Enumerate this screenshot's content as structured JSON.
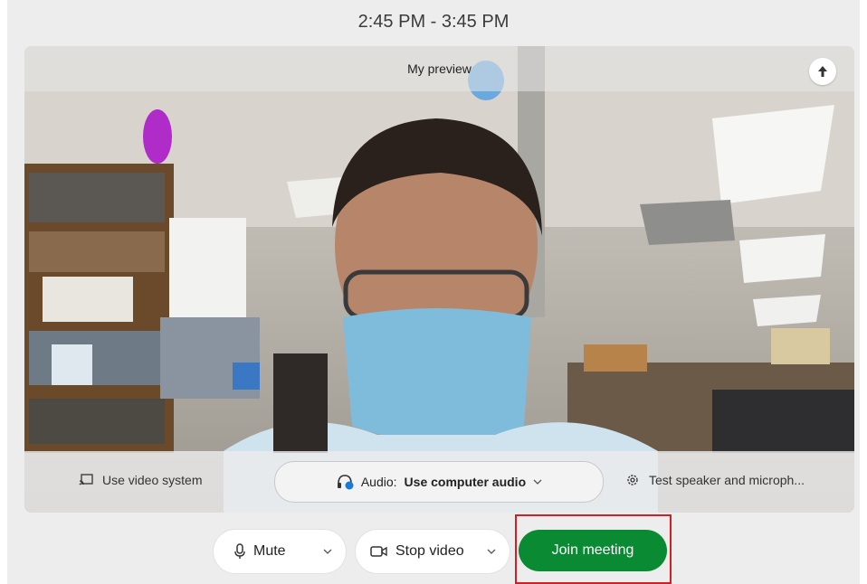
{
  "header": {
    "time_range": "2:45 PM - 3:45 PM"
  },
  "preview": {
    "label": "My preview",
    "pin_icon": "pin-icon"
  },
  "bottom_bar": {
    "use_video_system": "Use video system",
    "audio_prefix": "Audio:",
    "audio_value": "Use computer audio",
    "test_speaker": "Test speaker and microph..."
  },
  "controls": {
    "mute_label": "Mute",
    "stop_video_label": "Stop video",
    "join_label": "Join meeting"
  },
  "colors": {
    "join_green": "#0a8a32",
    "highlight_red": "#d21f26"
  }
}
